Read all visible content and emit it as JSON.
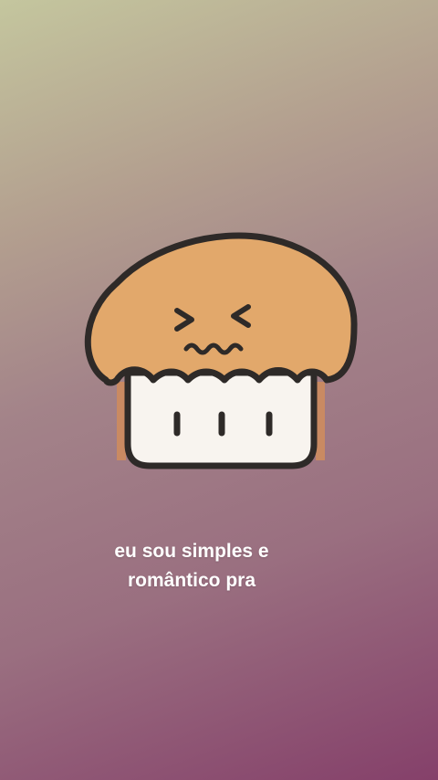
{
  "caption": {
    "line1": "eu sou simples e",
    "line2": "romântico pra"
  },
  "sticker": {
    "icon": "muffin-icon",
    "top_color": "#e2a86b",
    "base_color": "#f8f4ef",
    "outline_color": "#2e2a28"
  },
  "background": {
    "gradient_start": "#c4c69e",
    "gradient_end": "#85406a"
  }
}
